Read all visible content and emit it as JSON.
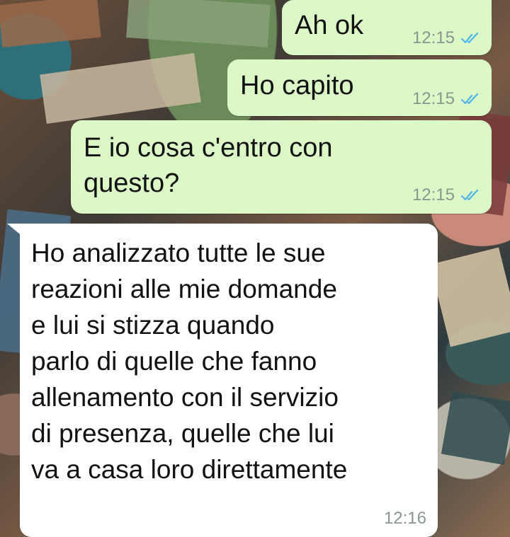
{
  "chat": {
    "messages": [
      {
        "direction": "outgoing",
        "text": "Ah ok",
        "time": "12:15",
        "status": "read",
        "status_icon": "double-check-blue"
      },
      {
        "direction": "outgoing",
        "text": "Ho capito",
        "time": "12:15",
        "status": "read",
        "status_icon": "double-check-blue"
      },
      {
        "direction": "outgoing",
        "text": "E io cosa c'entro con\nquesto?",
        "time": "12:15",
        "status": "read",
        "status_icon": "double-check-blue"
      },
      {
        "direction": "incoming",
        "text": "Ho analizzato tutte le sue\nreazioni alle mie domande\ne lui si stizza quando\nparlo di quelle che fanno\nallenamento con il servizio\ndi presenza, quelle che lui\nva a casa loro direttamente",
        "time": "12:16"
      }
    ]
  },
  "colors": {
    "outgoing_bubble": "#dcf8c6",
    "incoming_bubble": "#ffffff",
    "read_ticks": "#4fb6ec",
    "timestamp": "#8c9691"
  }
}
